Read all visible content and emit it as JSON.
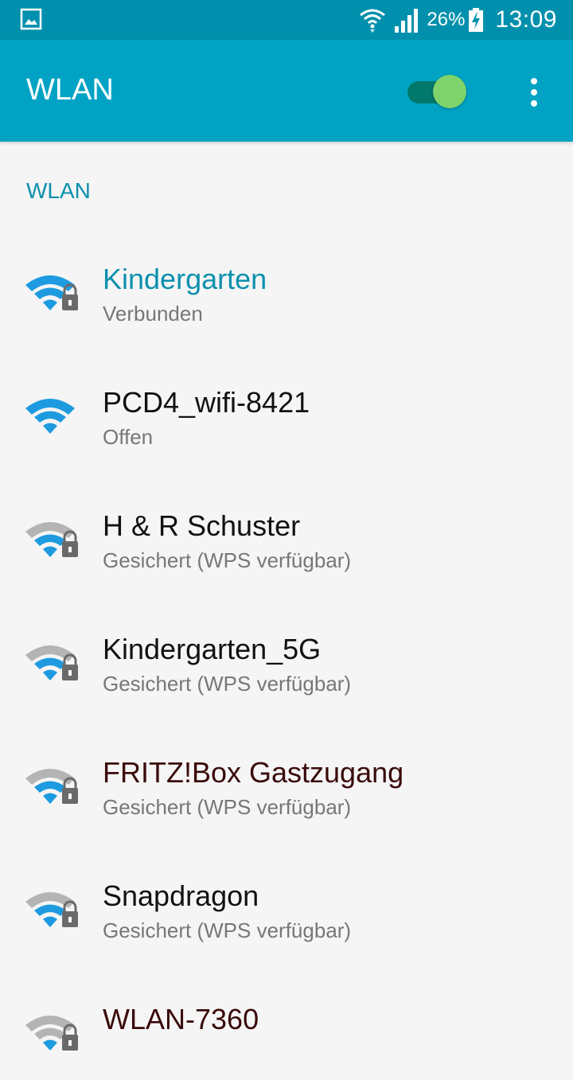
{
  "status_bar": {
    "battery_percent": "26%",
    "time": "13:09",
    "icons": [
      "gallery-icon",
      "wifi-icon",
      "signal-icon",
      "battery-charging-icon"
    ]
  },
  "app_bar": {
    "title": "WLAN",
    "toggle_state": "on",
    "colors": {
      "background": "#00a3c4",
      "toggle_track": "#00786a",
      "toggle_thumb": "#7ed36a"
    }
  },
  "section": {
    "header": "WLAN"
  },
  "networks": [
    {
      "name": "Kindergarten",
      "status": "Verbunden",
      "signal": "strong",
      "secured": true,
      "connected": true,
      "name_color": "#0c90ad"
    },
    {
      "name": "PCD4_wifi-8421",
      "status": "Offen",
      "signal": "strong",
      "secured": false,
      "connected": false,
      "name_color": "#111111"
    },
    {
      "name": "H & R Schuster",
      "status": "Gesichert (WPS verfügbar)",
      "signal": "medium",
      "secured": true,
      "connected": false,
      "name_color": "#111111"
    },
    {
      "name": "Kindergarten_5G",
      "status": "Gesichert (WPS verfügbar)",
      "signal": "medium",
      "secured": true,
      "connected": false,
      "name_color": "#111111"
    },
    {
      "name": "FRITZ!Box Gastzugang",
      "status": "Gesichert (WPS verfügbar)",
      "signal": "medium",
      "secured": true,
      "connected": false,
      "name_color": "#3a0a0a"
    },
    {
      "name": "Snapdragon",
      "status": "Gesichert (WPS verfügbar)",
      "signal": "medium",
      "secured": true,
      "connected": false,
      "name_color": "#111111"
    },
    {
      "name": "WLAN-7360",
      "status": "",
      "signal": "weak",
      "secured": true,
      "connected": false,
      "name_color": "#3a0a0a"
    }
  ]
}
